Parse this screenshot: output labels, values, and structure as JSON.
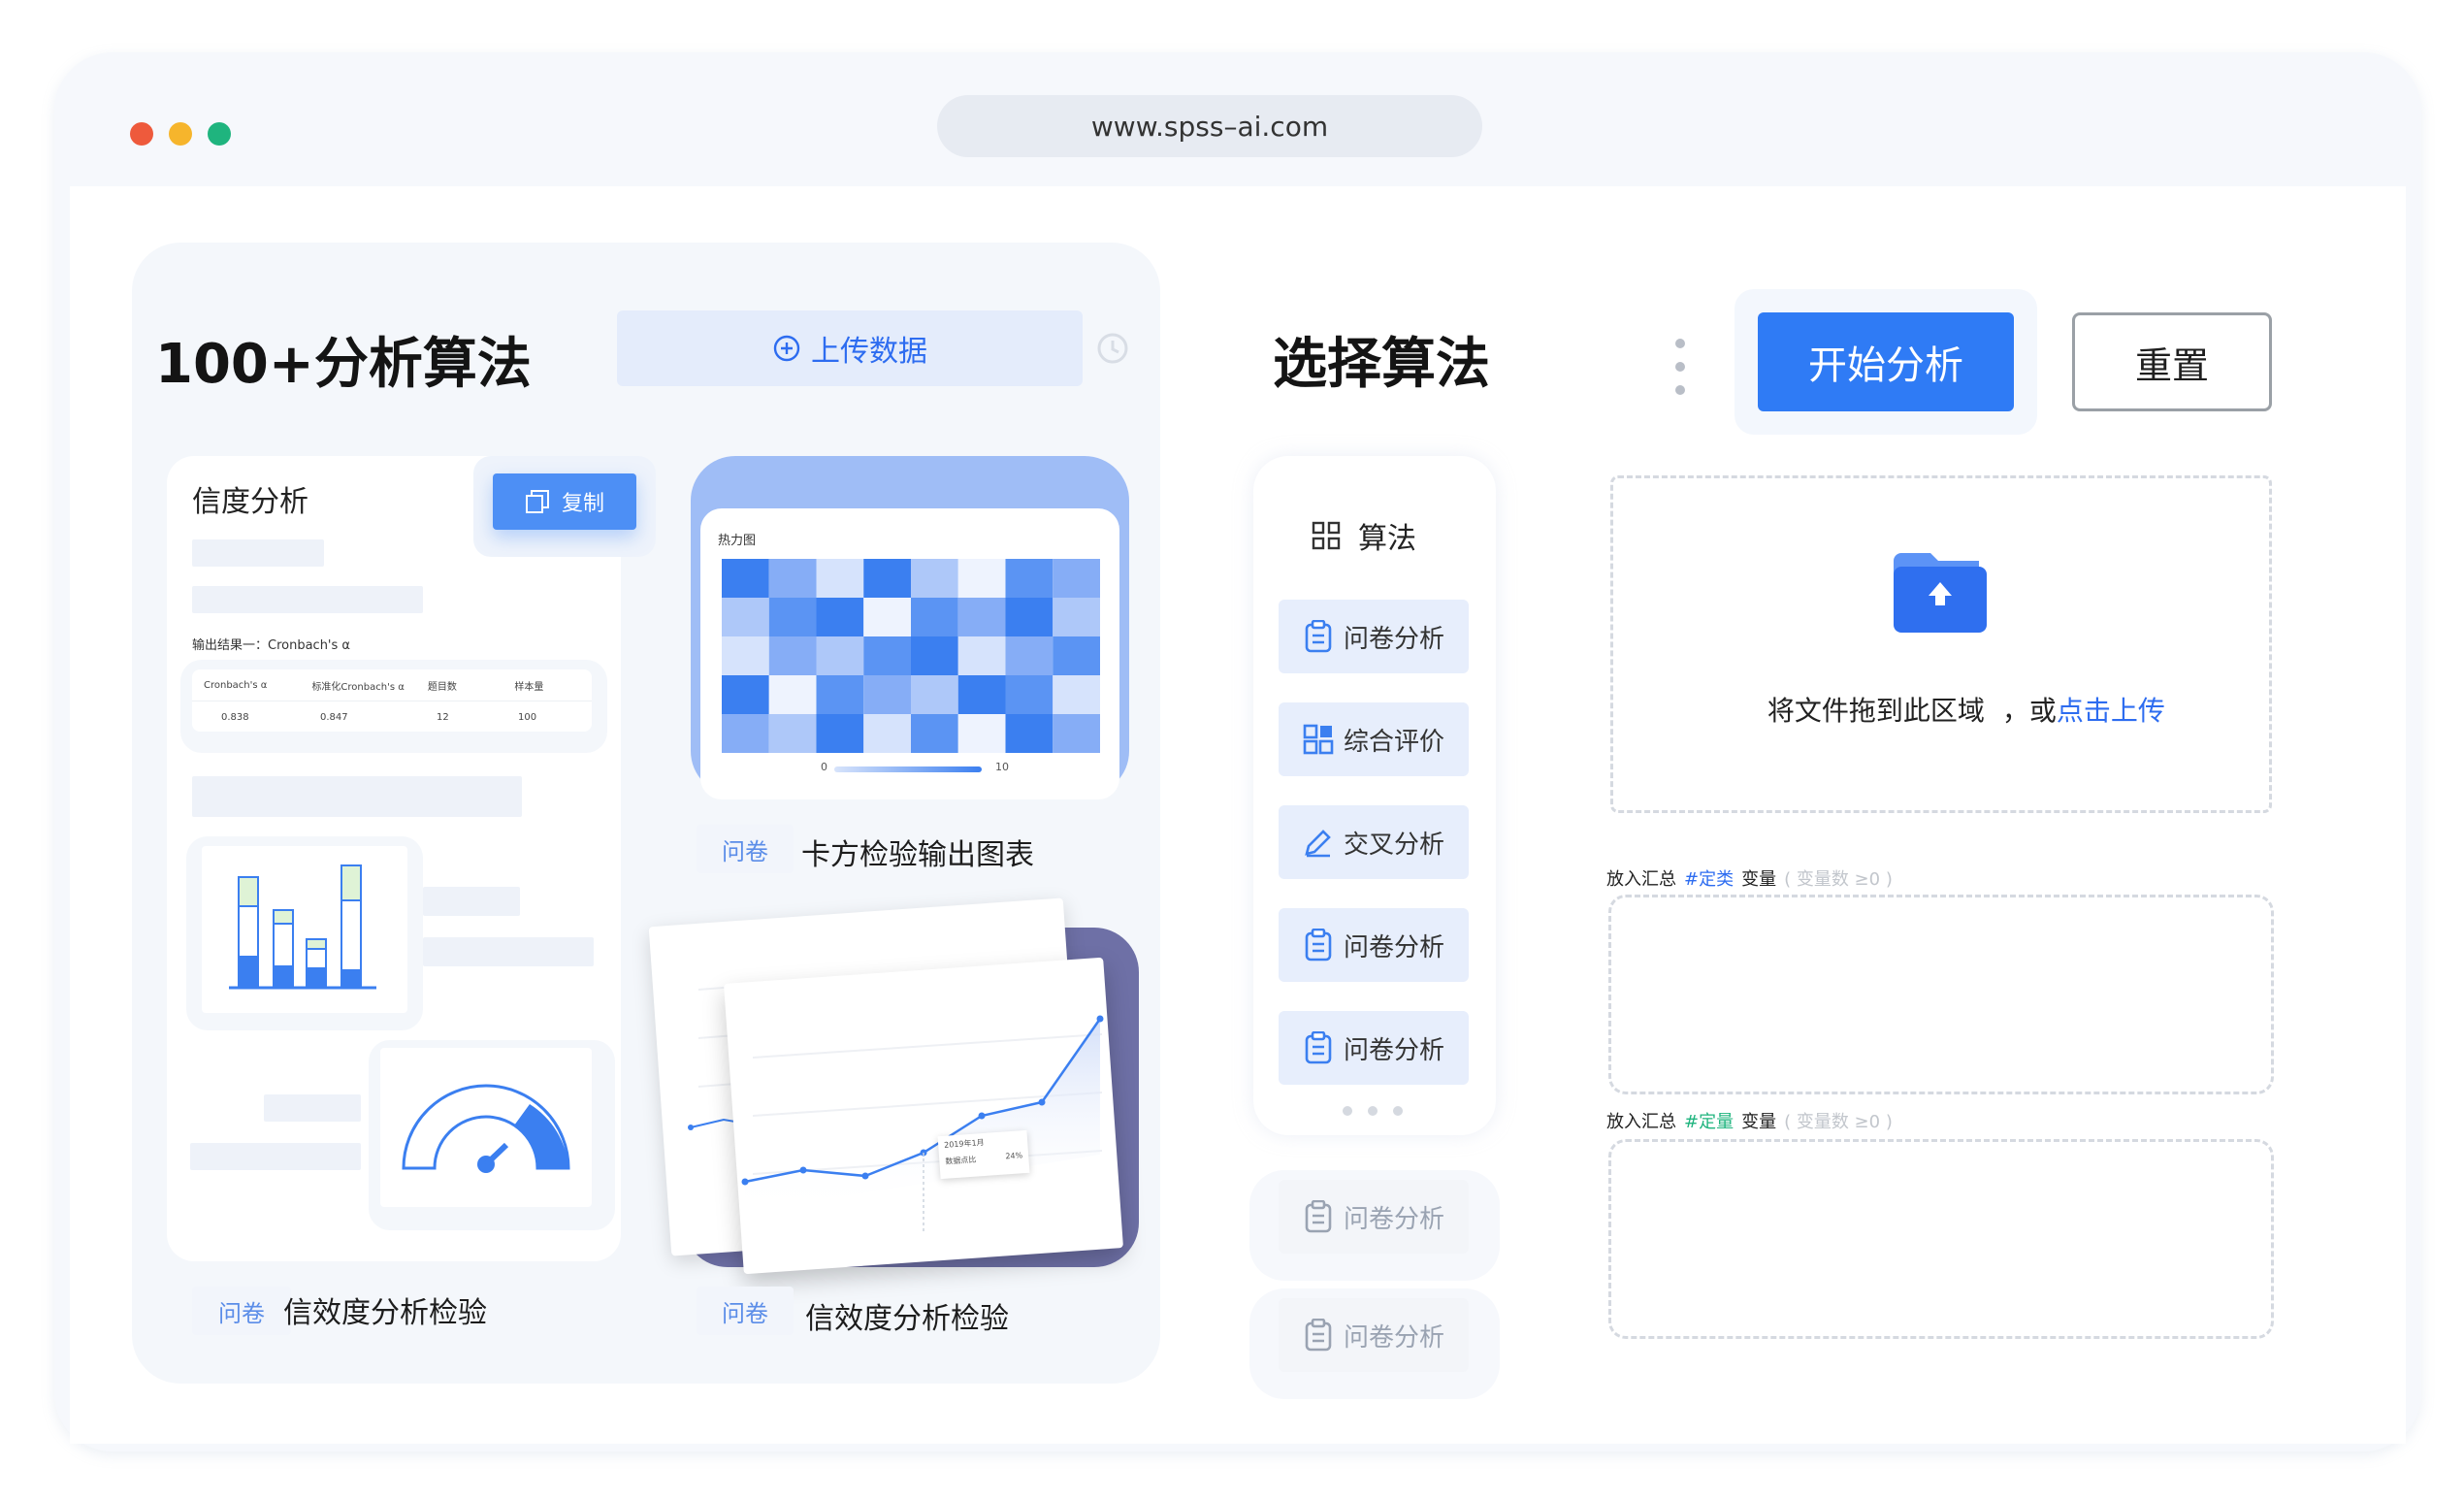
{
  "browser": {
    "url": "www.spss–ai.com",
    "dot_colors": [
      "#ee5a3c",
      "#f6b52c",
      "#1fb47e"
    ]
  },
  "left": {
    "title": "100+分析算法",
    "upload_label": "上传数据",
    "reliability_card": {
      "title": "信度分析",
      "copy_label": "复制",
      "output_caption": "输出结果一：Cronbach's α",
      "table": {
        "headers": [
          "Cronbach's α",
          "标准化Cronbach's α",
          "题目数",
          "样本量"
        ],
        "row": [
          "0.838",
          "0.847",
          "12",
          "100"
        ]
      }
    },
    "heatmap_card": {
      "title": "热力图",
      "scale_min": "0",
      "scale_max": "10",
      "tag": "问卷",
      "caption": "卡方检验输出图表"
    },
    "line_card": {
      "tooltip_date": "2019年1月",
      "tooltip_label": "数据点比",
      "tooltip_value": "24%",
      "tag": "问卷",
      "caption": "信效度分析检验"
    },
    "bottom_left": {
      "tag": "问卷",
      "caption": "信效度分析检验"
    }
  },
  "right": {
    "title": "选择算法",
    "start_label": "开始分析",
    "reset_label": "重置",
    "algo_header": "算法",
    "algo_items": [
      "问卷分析",
      "综合评价",
      "交叉分析",
      "问卷分析",
      "问卷分析"
    ],
    "algo_items_dim": [
      "问卷分析",
      "问卷分析"
    ],
    "dropzone": {
      "text": "将文件拖到此区域",
      "or": "，或",
      "link": "点击上传"
    },
    "zone1": {
      "prefix": "放入汇总",
      "type": "#定类",
      "type_color": "#2d6cf0",
      "suffix": "变量",
      "hint": "( 变量数 ≥0 )"
    },
    "zone2": {
      "prefix": "放入汇总",
      "type": "#定量",
      "type_color": "#1fb47e",
      "suffix": "变量",
      "hint": "( 变量数 ≥0 )"
    }
  }
}
